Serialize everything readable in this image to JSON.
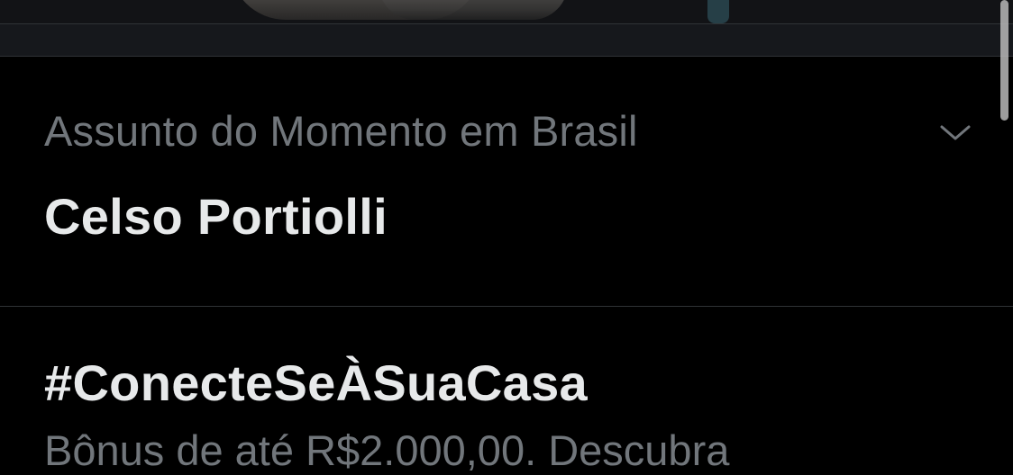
{
  "trends": [
    {
      "meta": "Assunto do Momento em Brasil",
      "title": "Celso Portiolli"
    },
    {
      "title": "#ConecteSeÀSuaCasa",
      "description": "Bônus de até R$2.000,00. Descubra"
    }
  ],
  "icons": {
    "more": "chevron-down-icon"
  },
  "colors": {
    "background": "#000000",
    "text_primary": "#e7e9ea",
    "text_secondary": "#71767b",
    "divider": "#2f3336",
    "separator_band": "#16181c"
  }
}
